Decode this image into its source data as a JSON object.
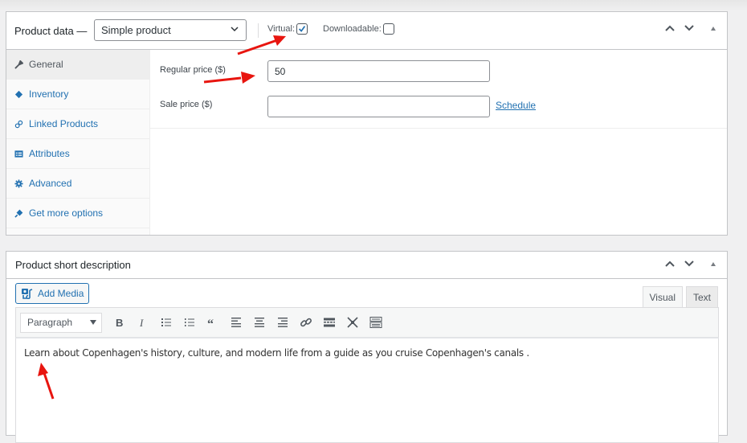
{
  "product_data": {
    "title": "Product data —",
    "product_type": "Simple product",
    "virtual_label": "Virtual:",
    "virtual_checked": true,
    "downloadable_label": "Downloadable:",
    "downloadable_checked": false,
    "tabs": [
      {
        "label": "General",
        "icon": "wrench-icon",
        "active": true
      },
      {
        "label": "Inventory",
        "icon": "tag-icon",
        "active": false
      },
      {
        "label": "Linked Products",
        "icon": "link-icon",
        "active": false
      },
      {
        "label": "Attributes",
        "icon": "list-table-icon",
        "active": false
      },
      {
        "label": "Advanced",
        "icon": "gear-icon",
        "active": false
      },
      {
        "label": "Get more options",
        "icon": "plugin-icon",
        "active": false
      }
    ],
    "general": {
      "regular_price_label": "Regular price ($)",
      "regular_price_value": "50",
      "sale_price_label": "Sale price ($)",
      "sale_price_value": "",
      "schedule_link": "Schedule"
    }
  },
  "short_description": {
    "title": "Product short description",
    "add_media_label": "Add Media",
    "editor_tabs": [
      {
        "label": "Visual",
        "active": true
      },
      {
        "label": "Text",
        "active": false
      }
    ],
    "format_select": "Paragraph",
    "toolbar_buttons": [
      "bold",
      "italic",
      "bulleted-list",
      "numbered-list",
      "blockquote",
      "align-left",
      "align-center",
      "align-right",
      "insert-link",
      "read-more",
      "fullscreen",
      "toolbar-toggle"
    ],
    "content": "Learn about Copenhagen's history, culture, and modern life from a guide as you cruise Copenhagen's canals ."
  },
  "colors": {
    "link": "#2271b1",
    "annotation_arrow": "#e8150f",
    "checkbox_check": "#2271b1"
  }
}
